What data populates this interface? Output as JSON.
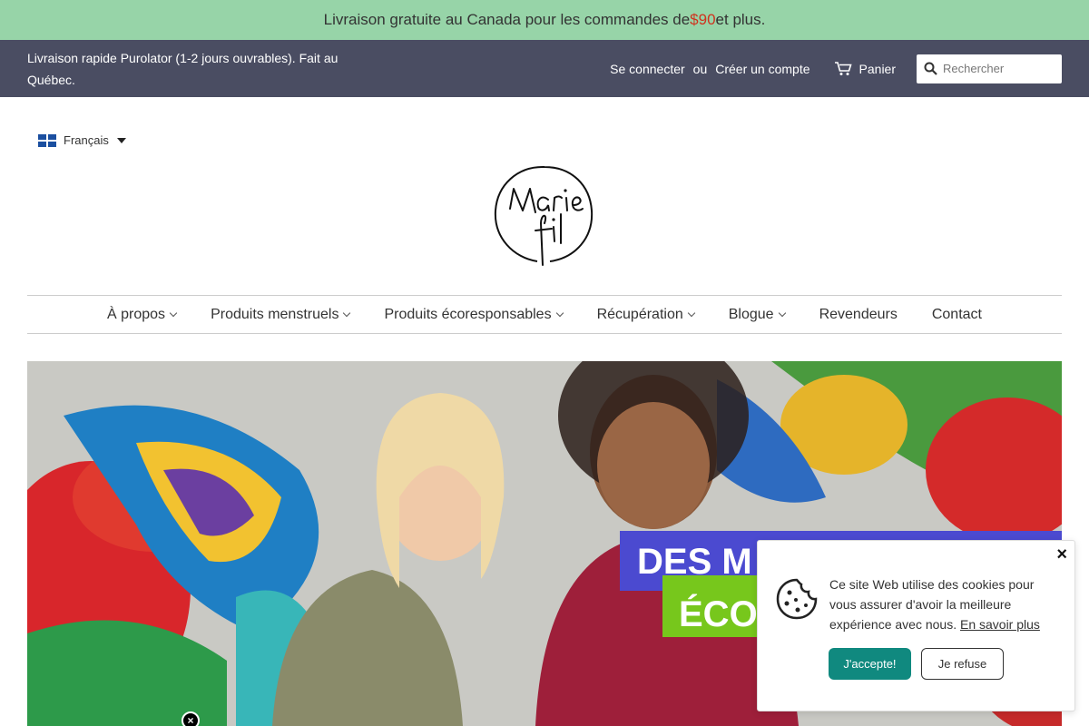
{
  "announcement": {
    "prefix": "Livraison gratuite au Canada pour les commandes de ",
    "price": "$90",
    "suffix": " et plus."
  },
  "topbar": {
    "shipping_text": "Livraison rapide Purolator (1-2 jours ouvrables). Fait au Québec.",
    "login_label": "Se connecter",
    "separator": "ou",
    "register_label": "Créer un compte",
    "cart_label": "Panier",
    "search_placeholder": "Rechercher"
  },
  "language": {
    "selected": "Français"
  },
  "nav": {
    "items": [
      {
        "label": "À propos"
      },
      {
        "label": "Produits menstruels"
      },
      {
        "label": "Produits écoresponsables"
      },
      {
        "label": "Récupération"
      },
      {
        "label": "Blogue"
      },
      {
        "label": "Revendeurs"
      },
      {
        "label": "Contact"
      }
    ]
  },
  "hero": {
    "banner_line1": "DES M",
    "banner_line2": "ÉCO"
  },
  "cookie": {
    "message": "Ce site Web utilise des cookies pour vous assurer d'avoir la meilleure expérience avec nous.",
    "learn_more": "En savoir plus",
    "accept_label": "J'accepte!",
    "refuse_label": "Je refuse",
    "close_symbol": "×"
  },
  "popup_close_symbol": "×",
  "colors": {
    "announcement_bg": "#97d4a8",
    "topbar_bg": "#4a4d62",
    "price_accent": "#d0321e",
    "accept_button": "#10897f"
  }
}
